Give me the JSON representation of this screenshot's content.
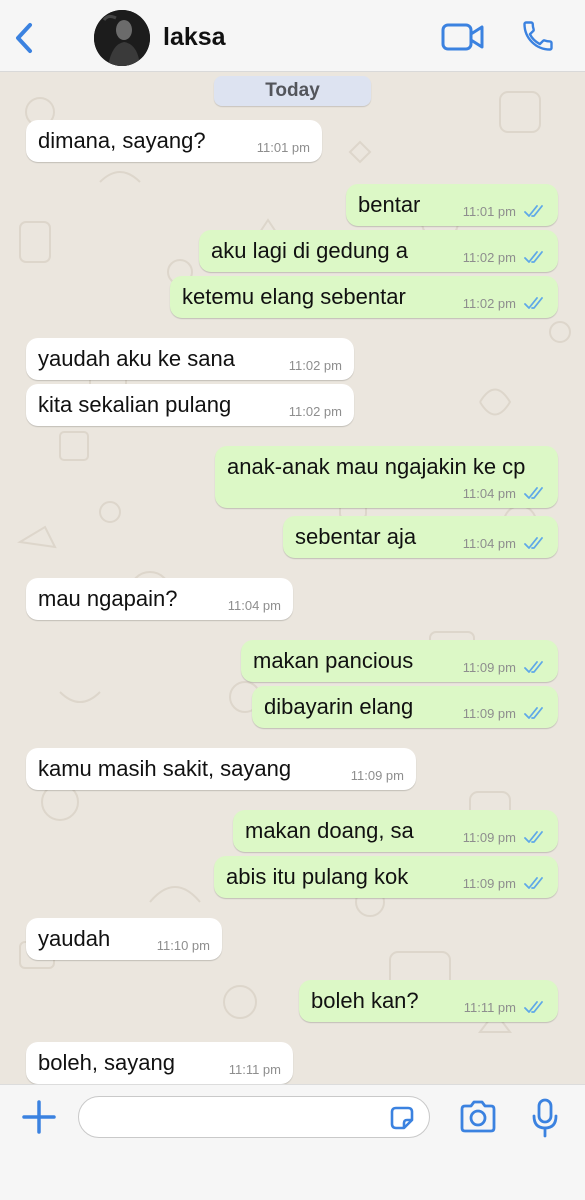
{
  "header": {
    "contact_name": "laksa",
    "back_icon": "chevron-left-icon",
    "video_icon": "video-camera-icon",
    "call_icon": "phone-icon",
    "accent_color": "#3b82e0"
  },
  "chat": {
    "date_label": "Today",
    "messages": [
      {
        "direction": "in",
        "text": "dimana, sayang?",
        "time": "11:01 pm"
      },
      {
        "direction": "out",
        "text": "bentar",
        "time": "11:01 pm",
        "status": "read"
      },
      {
        "direction": "out",
        "text": "aku lagi di gedung a",
        "time": "11:02 pm",
        "status": "read"
      },
      {
        "direction": "out",
        "text": "ketemu elang sebentar",
        "time": "11:02 pm",
        "status": "read"
      },
      {
        "direction": "in",
        "text": "yaudah aku ke sana",
        "time": "11:02 pm"
      },
      {
        "direction": "in",
        "text": "kita sekalian pulang",
        "time": "11:02 pm"
      },
      {
        "direction": "out",
        "text": "anak-anak mau ngajakin ke cp",
        "time": "11:04 pm",
        "status": "read"
      },
      {
        "direction": "out",
        "text": "sebentar aja",
        "time": "11:04 pm",
        "status": "read"
      },
      {
        "direction": "in",
        "text": "mau ngapain?",
        "time": "11:04 pm"
      },
      {
        "direction": "out",
        "text": "makan pancious",
        "time": "11:09 pm",
        "status": "read"
      },
      {
        "direction": "out",
        "text": "dibayarin elang",
        "time": "11:09 pm",
        "status": "read"
      },
      {
        "direction": "in",
        "text": "kamu masih sakit, sayang",
        "time": "11:09 pm"
      },
      {
        "direction": "out",
        "text": "makan doang, sa",
        "time": "11:09 pm",
        "status": "read"
      },
      {
        "direction": "out",
        "text": "abis itu pulang kok",
        "time": "11:09 pm",
        "status": "read"
      },
      {
        "direction": "in",
        "text": "yaudah",
        "time": "11:10 pm"
      },
      {
        "direction": "out",
        "text": "boleh kan?",
        "time": "11:11 pm",
        "status": "read"
      },
      {
        "direction": "in",
        "text": "boleh, sayang",
        "time": "11:11 pm"
      }
    ]
  },
  "composer": {
    "placeholder": "",
    "plus_icon": "plus-icon",
    "sticker_icon": "sticker-icon",
    "camera_icon": "camera-icon",
    "mic_icon": "microphone-icon"
  },
  "colors": {
    "outgoing_bubble": "#dcf8c6",
    "incoming_bubble": "#ffffff",
    "read_ticks": "#5fa8e8"
  }
}
